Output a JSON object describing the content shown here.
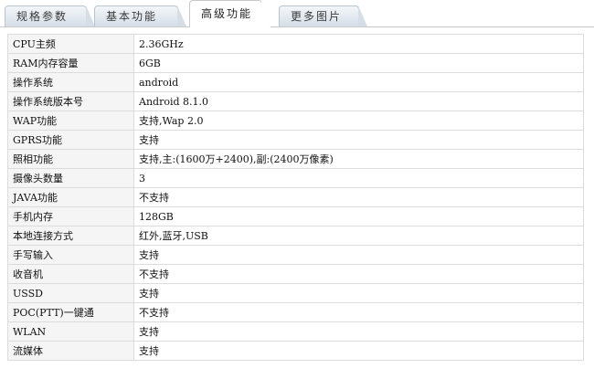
{
  "tabs": [
    {
      "label": "规格参数",
      "active": false
    },
    {
      "label": "基本功能",
      "active": false
    },
    {
      "label": "高级功能",
      "active": true
    },
    {
      "label": "更多图片",
      "active": false
    }
  ],
  "specs": [
    {
      "label": "CPU主频",
      "value": "2.36GHz"
    },
    {
      "label": "RAM内存容量",
      "value": "6GB"
    },
    {
      "label": "操作系统",
      "value": "android"
    },
    {
      "label": "操作系统版本号",
      "value": "Android 8.1.0"
    },
    {
      "label": "WAP功能",
      "value": "支持,Wap 2.0"
    },
    {
      "label": "GPRS功能",
      "value": "支持"
    },
    {
      "label": "照相功能",
      "value": "支持,主:(1600万+2400),副:(2400万像素)"
    },
    {
      "label": "摄像头数量",
      "value": "3"
    },
    {
      "label": "JAVA功能",
      "value": "不支持"
    },
    {
      "label": "手机内存",
      "value": "128GB"
    },
    {
      "label": "本地连接方式",
      "value": "红外,蓝牙,USB"
    },
    {
      "label": "手写输入",
      "value": "支持"
    },
    {
      "label": "收音机",
      "value": "不支持"
    },
    {
      "label": "USSD",
      "value": "支持"
    },
    {
      "label": "POC(PTT)一键通",
      "value": "不支持"
    },
    {
      "label": "WLAN",
      "value": "支持"
    },
    {
      "label": "流媒体",
      "value": "支持"
    }
  ]
}
